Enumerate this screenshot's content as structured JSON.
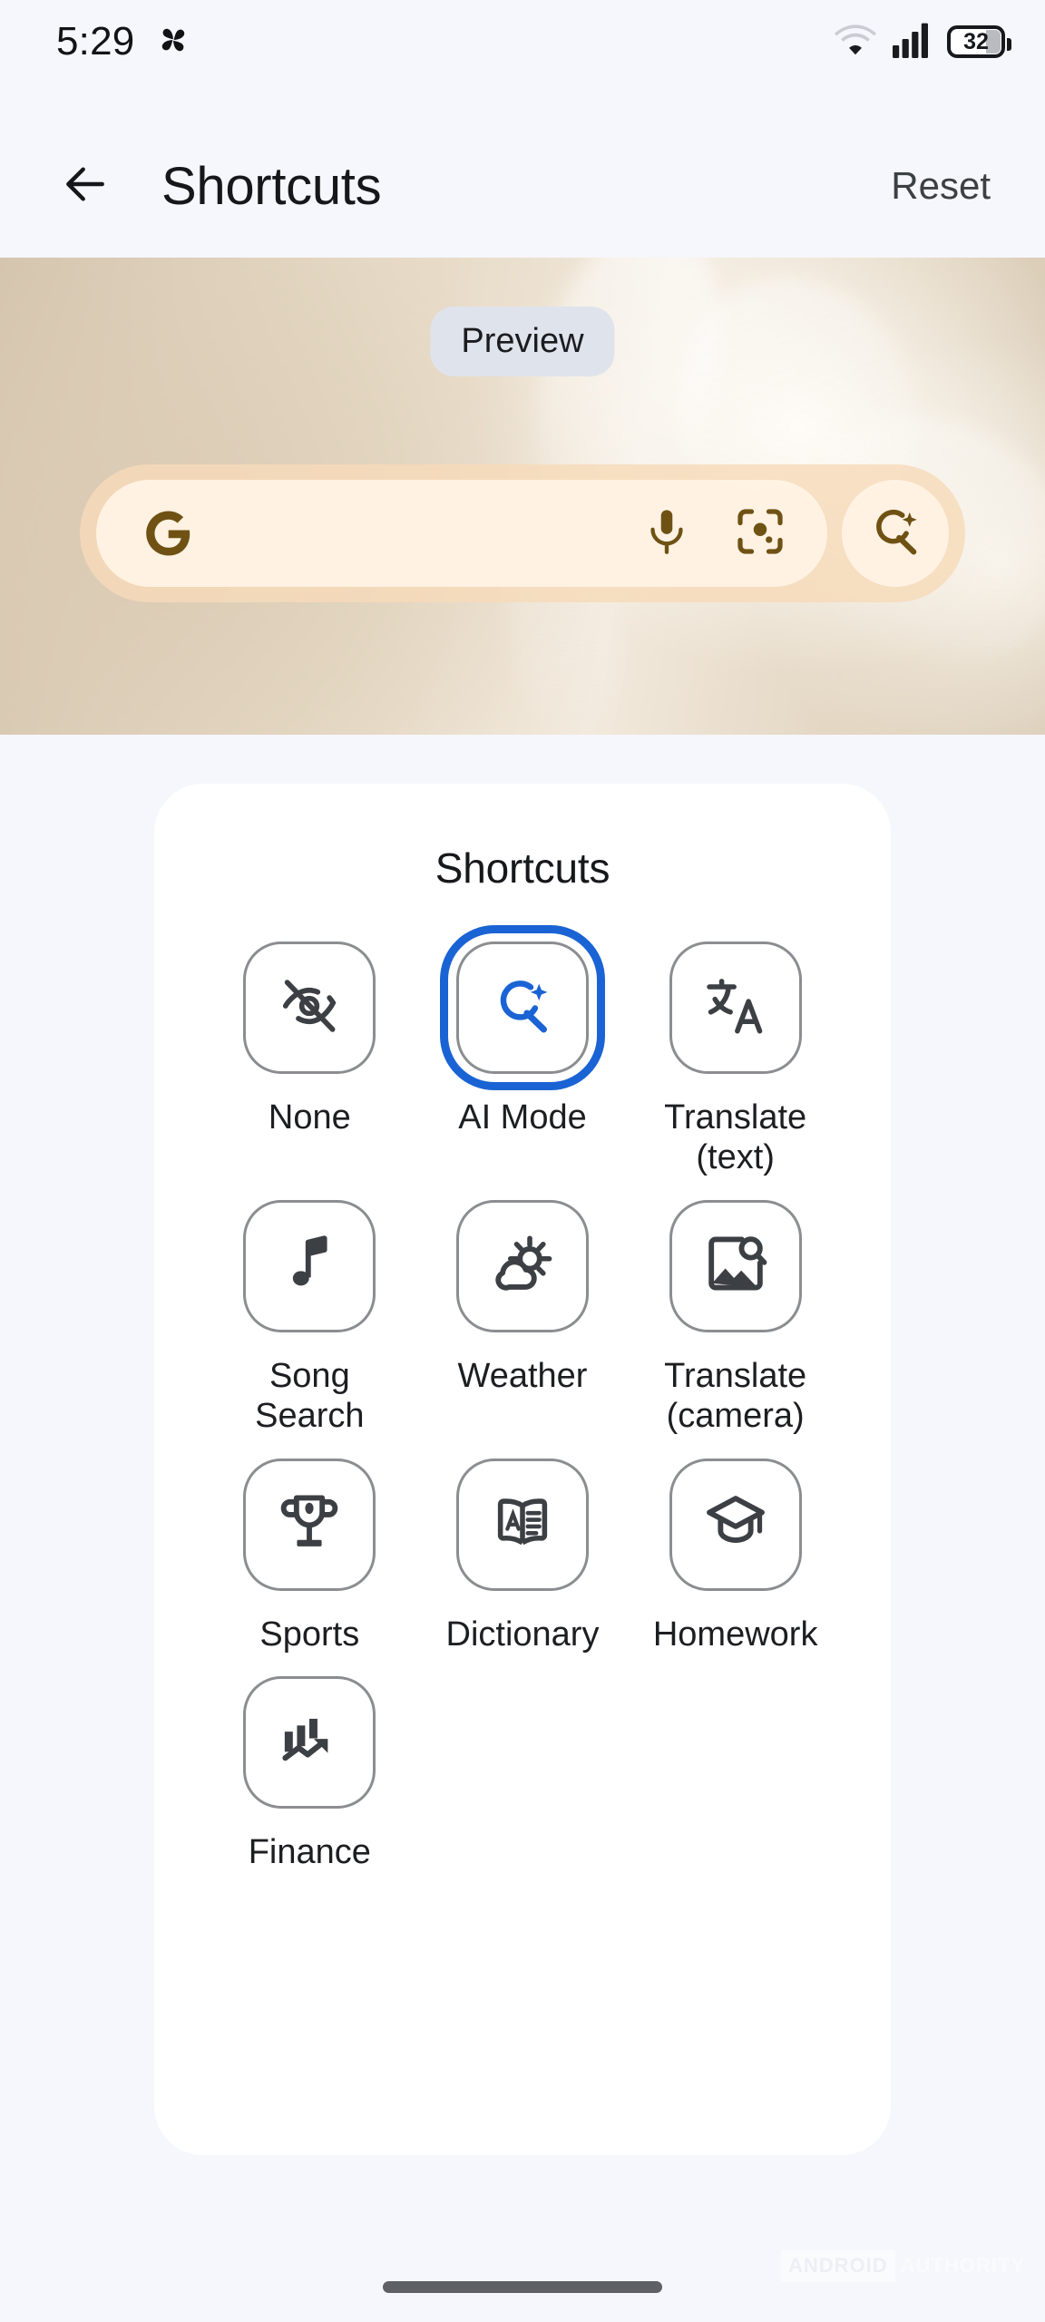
{
  "status_bar": {
    "time": "5:29",
    "left_icon": "pinwheel-icon",
    "wifi_icon": "wifi-icon",
    "signal_icon": "cellular-signal-icon",
    "battery_percent": "32",
    "battery_level": 32
  },
  "header": {
    "back_icon": "back-arrow-icon",
    "title": "Shortcuts",
    "reset_label": "Reset"
  },
  "preview": {
    "chip_label": "Preview",
    "widget": {
      "google_logo": "google-g-icon",
      "mic_icon": "microphone-icon",
      "lens_icon": "google-lens-icon",
      "ai_mode_icon": "ai-mode-search-sparkle-icon"
    }
  },
  "shortcuts_card": {
    "title": "Shortcuts",
    "selected_index": 1,
    "selection_color": "#1a63d4",
    "tiles": [
      {
        "label": "None",
        "icon": "eye-off-icon",
        "selected": false
      },
      {
        "label": "AI Mode",
        "icon": "ai-mode-search-sparkle-icon",
        "selected": true
      },
      {
        "label": "Translate\n(text)",
        "icon": "translate-text-icon",
        "selected": false
      },
      {
        "label": "Song\nSearch",
        "icon": "music-note-icon",
        "selected": false
      },
      {
        "label": "Weather",
        "icon": "partly-cloudy-sun-icon",
        "selected": false
      },
      {
        "label": "Translate\n(camera)",
        "icon": "image-search-icon",
        "selected": false
      },
      {
        "label": "Sports",
        "icon": "trophy-icon",
        "selected": false
      },
      {
        "label": "Dictionary",
        "icon": "open-book-icon",
        "selected": false
      },
      {
        "label": "Homework",
        "icon": "graduation-cap-icon",
        "selected": false
      },
      {
        "label": "Finance",
        "icon": "finance-chart-icon",
        "selected": false
      }
    ]
  },
  "watermark": {
    "box_text": "ANDROID",
    "plain_text": "AUTHORITY"
  },
  "colors": {
    "page_background": "#f6f7fc",
    "card_background": "#ffffff",
    "accent_blue": "#1a63d4",
    "widget_brown": "#7a5a1e",
    "icon_gray": "#3c3f43"
  }
}
